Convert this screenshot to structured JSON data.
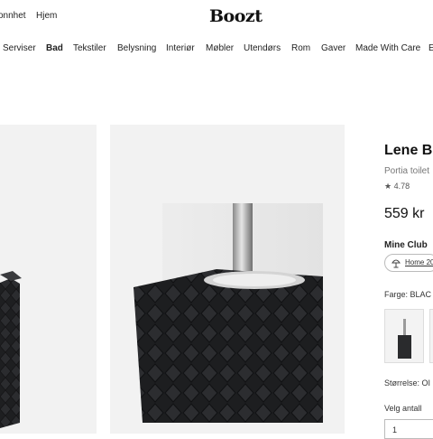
{
  "header": {
    "top_links": [
      "onnhet",
      "Hjem"
    ],
    "logo": "Boozt"
  },
  "nav": {
    "items": [
      {
        "label": "Serviser",
        "active": false
      },
      {
        "label": "Bad",
        "active": true
      },
      {
        "label": "Tekstiler",
        "active": false
      },
      {
        "label": "Belysning",
        "active": false
      },
      {
        "label": "Interiør",
        "active": false
      },
      {
        "label": "Møbler",
        "active": false
      },
      {
        "label": "Utendørs",
        "active": false
      },
      {
        "label": "Rom",
        "active": false
      },
      {
        "label": "Gaver",
        "active": false
      },
      {
        "label": "Made With Care",
        "active": false
      },
      {
        "label": "E",
        "active": false
      }
    ]
  },
  "product": {
    "brand": "Lene B",
    "subtitle": "Portia toilet",
    "rating": "4.78",
    "price": "559 kr",
    "club_label": "Mine Club",
    "club_chip": "Home 20",
    "color_label": "Farge: BLAC",
    "size_label": "Størrelse: OI",
    "qty_label": "Velg antall",
    "qty_value": "1",
    "colors": {
      "product": "#1e1f21",
      "chrome": "#b8b8b8",
      "panel": "#f2f2f2"
    }
  }
}
